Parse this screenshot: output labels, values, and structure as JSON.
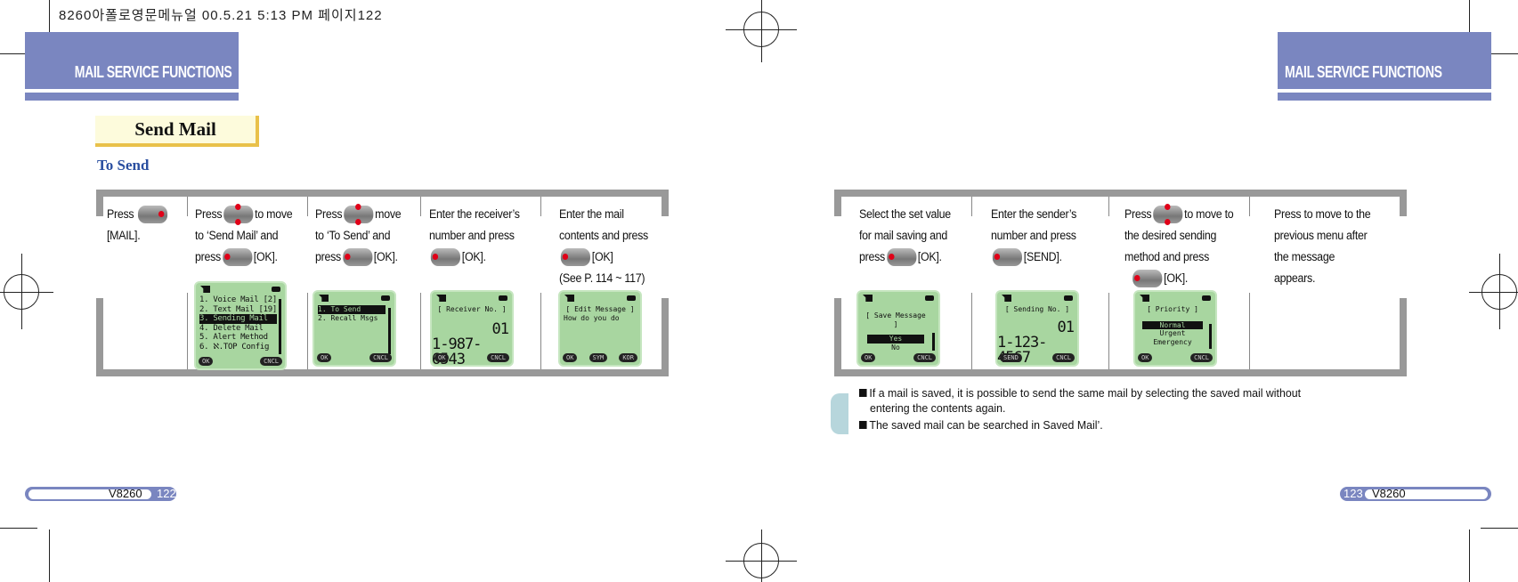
{
  "print_header": "8260아폴로영문메뉴얼   00.5.21 5:13 PM 페이지122",
  "section_title": "MAIL SERVICE FUNCTIONS",
  "heading": "Send Mail",
  "subheading": "To Send",
  "icons": {
    "key": "navigation-key-icon",
    "signal": "signal-icon",
    "battery": "battery-icon"
  },
  "colors": {
    "band": "#7a86c0",
    "heading_bg": "#fdfbdc",
    "heading_border": "#e9c14a",
    "subheading": "#2a4fa0",
    "lcd": "#a8d6a0"
  },
  "left_steps": [
    {
      "t1": "Press",
      "t2": "[MAIL]."
    },
    {
      "t1": "Press",
      "t1b": "to move",
      "t2": "to ‘Send Mail’ and",
      "t3a": "press",
      "t3b": "[OK]."
    },
    {
      "t1": "Press",
      "t1b": "move",
      "t2": "to ‘To Send’ and",
      "t3a": "press",
      "t3b": "[OK]."
    },
    {
      "t1": "Enter the receiver’s",
      "t2": "number and press",
      "t3b": "[OK]."
    },
    {
      "t1": "Enter the mail",
      "t2": "contents and press",
      "t3b": "[OK]",
      "t4": "(See P. 114 ~ 117)"
    }
  ],
  "right_steps": [
    {
      "t1": "Select the set value",
      "t2": "for mail saving and",
      "t3a": "press",
      "t3b": "[OK]."
    },
    {
      "t1": "Enter the sender’s",
      "t2": "number and press",
      "t3b": "[SEND]."
    },
    {
      "t1": "Press",
      "t1b": "to move to",
      "t2": "the desired sending",
      "t3": "method and press",
      "t4b": "[OK]."
    },
    {
      "t1": "Press to move to the",
      "t2": "previous menu after",
      "t3": "the message",
      "t4": "appears."
    }
  ],
  "screens": {
    "mail_menu": {
      "items": [
        "1. Voice Mail [2]",
        "2. Text Mail [19]",
        "3. Sending Mail",
        "4. Delete Mail",
        "5. Alert Method",
        "6. ℵ.TOP Config"
      ],
      "selected": 2,
      "soft": [
        "OK",
        "CNCL"
      ]
    },
    "send_menu": {
      "items": [
        "1. To Send",
        "2. Recall Msgs"
      ],
      "selected": 0,
      "soft": [
        "OK",
        "CNCL"
      ]
    },
    "receiver": {
      "title": "[ Receiver No. ]",
      "line1": "01",
      "line2": "1-987-6543",
      "soft": [
        "OK",
        "CNCL"
      ]
    },
    "edit": {
      "title": "[ Edit Message ]",
      "text": "How do you do",
      "soft": [
        "OK",
        "SYM",
        "KOR"
      ]
    },
    "save": {
      "title": "[ Save Message ]",
      "opts": [
        "Yes",
        "No"
      ],
      "soft": [
        "OK",
        "CNCL"
      ]
    },
    "sending": {
      "title": "[ Sending No. ]",
      "line1": "01",
      "line2": "1-123-4567",
      "soft": [
        "SEND",
        "CNCL"
      ]
    },
    "priority": {
      "title": "[ Priority ]",
      "opts": [
        "Normal",
        "Urgent",
        "Emergency"
      ],
      "soft": [
        "OK",
        "CNCL"
      ]
    }
  },
  "notes": [
    "If a mail is saved,  it is possible to send the  same mail by selecting the saved  mail without",
    "entering the contents again.",
    "The saved mail can be searched in  Saved Mail’."
  ],
  "footer_left": {
    "model": "V8260",
    "page": "122"
  },
  "footer_right": {
    "model": "V8260",
    "page": "123"
  }
}
